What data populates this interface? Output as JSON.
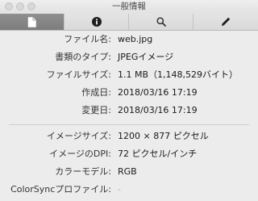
{
  "window": {
    "title": "一般情報"
  },
  "toolbar": {
    "tabs": [
      {
        "icon": "document-icon",
        "active": true
      },
      {
        "icon": "info-icon",
        "active": false
      },
      {
        "icon": "search-icon",
        "active": false
      },
      {
        "icon": "pencil-icon",
        "active": false
      }
    ]
  },
  "info": {
    "file_name": {
      "label": "ファイル名:",
      "value": "web.jpg"
    },
    "doc_type": {
      "label": "書類のタイプ:",
      "value": "JPEGイメージ"
    },
    "file_size": {
      "label": "ファイルサイズ:",
      "value": "1.1 MB（1,148,529バイト）"
    },
    "created": {
      "label": "作成日:",
      "value": "2018/03/16 17:19"
    },
    "modified": {
      "label": "変更日:",
      "value": "2018/03/16 17:19"
    },
    "image_size": {
      "label": "イメージサイズ:",
      "value": "1200 × 877 ピクセル"
    },
    "image_dpi": {
      "label": "イメージのDPI:",
      "value": "72 ピクセル/インチ"
    },
    "color_model": {
      "label": "カラーモデル:",
      "value": "RGB"
    },
    "colorsync_profile": {
      "label": "ColorSyncプロファイル:",
      "value": "-"
    }
  }
}
